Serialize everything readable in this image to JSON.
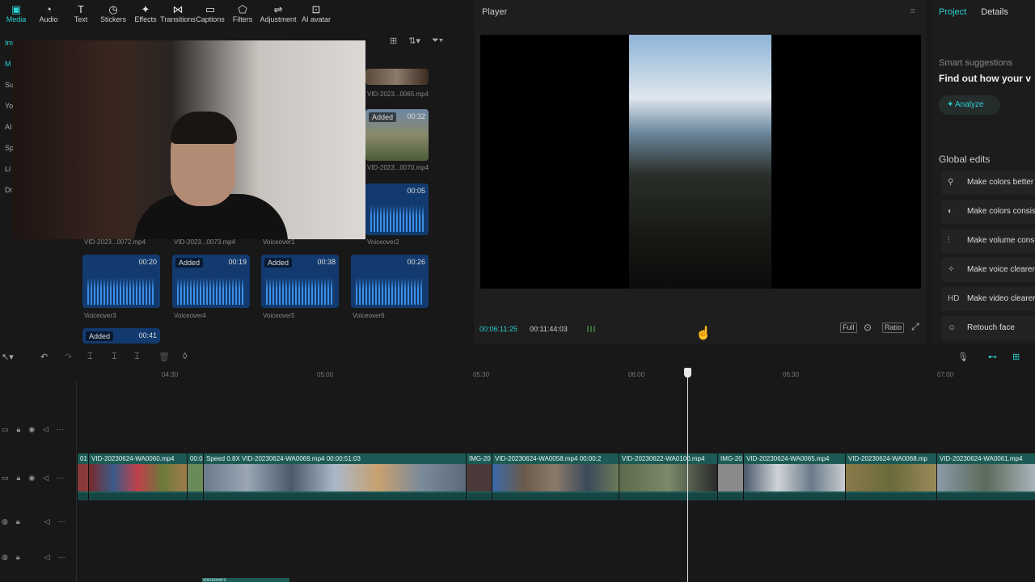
{
  "toolbar": {
    "items": [
      {
        "label": "Media",
        "icon": "media-icon",
        "active": true
      },
      {
        "label": "Audio",
        "icon": "audio-icon"
      },
      {
        "label": "Text",
        "icon": "text-icon"
      },
      {
        "label": "Stickers",
        "icon": "stickers-icon"
      },
      {
        "label": "Effects",
        "icon": "effects-icon"
      },
      {
        "label": "Transitions",
        "icon": "transitions-icon"
      },
      {
        "label": "Captions",
        "icon": "captions-icon"
      },
      {
        "label": "Filters",
        "icon": "filters-icon"
      },
      {
        "label": "Adjustment",
        "icon": "adjustment-icon"
      },
      {
        "label": "AI avatar",
        "icon": "ai-avatar-icon"
      }
    ]
  },
  "leftnav": [
    "Im",
    "M",
    "Su",
    "Yo",
    "AI",
    "Sp",
    "Li",
    "Dr"
  ],
  "media": {
    "clips": [
      {
        "name": "VID-2023...0065.mp4"
      },
      {
        "name": "VID-2023...0070.mp4",
        "duration": "00:32",
        "added": "Added"
      },
      {
        "name": "Voiceover2",
        "duration": "00:05"
      },
      {
        "name": "VID-2023...0072.mp4"
      },
      {
        "name": "VID-2023...0073.mp4"
      },
      {
        "name": "Voiceover1"
      },
      {
        "name": "Voiceover3",
        "duration": "00:20"
      },
      {
        "name": "Voiceover4",
        "duration": "00:19",
        "added": "Added"
      },
      {
        "name": "Voiceover5",
        "duration": "00:38",
        "added": "Added"
      },
      {
        "name": "Voiceover6",
        "duration": "00:26"
      },
      {
        "name": "",
        "duration": "00:41",
        "added": "Added"
      }
    ]
  },
  "player": {
    "title": "Player",
    "current_time": "00:06:11:25",
    "total_time": "00:11:44:03",
    "controls": [
      "Full",
      "Ratio"
    ]
  },
  "right_panel": {
    "tabs": [
      "Project",
      "Details"
    ],
    "smart_suggestions": "Smart suggestions",
    "headline": "Find out how your v",
    "analyze": "Analyze",
    "global_edits": "Global edits",
    "items": [
      {
        "label": "Make colors better",
        "icon": "magic-wand-icon"
      },
      {
        "label": "Make colors consis",
        "icon": "color-icon"
      },
      {
        "label": "Make volume cons",
        "icon": "volume-icon"
      },
      {
        "label": "Make voice clearer",
        "icon": "voice-icon"
      },
      {
        "label": "Make video clearer",
        "icon": "hd-icon"
      },
      {
        "label": "Retouch face",
        "icon": "face-icon"
      }
    ]
  },
  "timeline": {
    "ruler": [
      "04:30",
      "05:00",
      "05:30",
      "06:00",
      "06:30",
      "07:00"
    ],
    "clips": [
      {
        "label": "01"
      },
      {
        "label": "VID-20230624-WA0060.mp4"
      },
      {
        "label": "00:0"
      },
      {
        "label": "Speed 0.8X  VID-20230624-WA0069.mp4  00:00:51:03"
      },
      {
        "label": "IMG-20"
      },
      {
        "label": "VID-20230624-WA0058.mp4  00:00:2"
      },
      {
        "label": "VID-20230622-WA0100.mp4"
      },
      {
        "label": "IMG-20"
      },
      {
        "label": "VID-20230624-WA0065.mp4"
      },
      {
        "label": "VID-20230624-WA0068.mp"
      },
      {
        "label": "VID-20230624-WA0061.mp4"
      }
    ],
    "bottom_clip": "Voiceover1"
  }
}
